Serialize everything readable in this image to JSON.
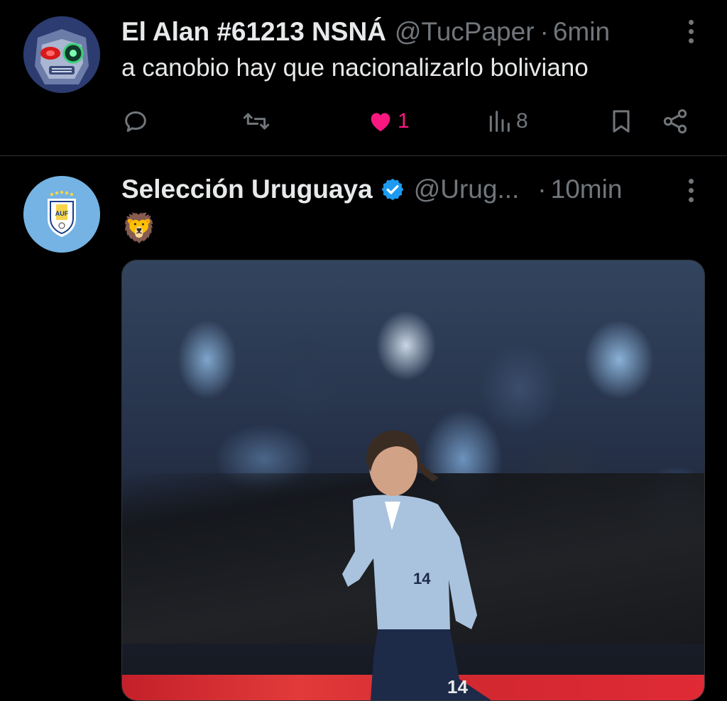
{
  "tweets": [
    {
      "author_name": "El Alan #61213 NSNÁ",
      "handle": "@TucPaper",
      "separator": "·",
      "time": "6min",
      "text": "a canobio hay que nacionalizarlo boliviano",
      "actions": {
        "reply_count": "",
        "retweet_count": "",
        "like_count": "1",
        "views_count": "8"
      },
      "liked": true
    },
    {
      "author_name": "Selección Uruguaya",
      "verified": true,
      "handle": "@Urug...",
      "separator": "·",
      "time": "10min",
      "text": "🦁",
      "media": {
        "type": "photo",
        "jersey_number": "14"
      }
    }
  ],
  "colors": {
    "background": "#000000",
    "text_primary": "#e7e9ea",
    "text_secondary": "#71767b",
    "like_active": "#f91880",
    "verified_blue": "#1d9bf0",
    "divider": "#2f3336"
  }
}
